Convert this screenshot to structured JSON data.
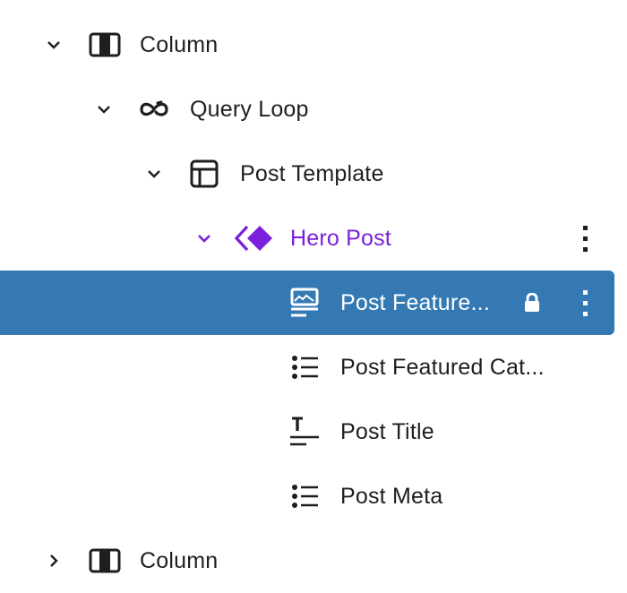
{
  "colors": {
    "text": "#1e1e1e",
    "accent_purple": "#7a1fdc",
    "selected_bg": "#3579b4",
    "selected_text": "#ffffff"
  },
  "list_view": {
    "items": [
      {
        "label": "Column",
        "icon": "columns-icon",
        "expanded": true,
        "level": 1
      },
      {
        "label": "Query Loop",
        "icon": "loop-icon",
        "expanded": true,
        "level": 2
      },
      {
        "label": "Post Template",
        "icon": "layout-icon",
        "expanded": true,
        "level": 3
      },
      {
        "label": "Hero Post",
        "icon": "reusable-block-icon",
        "expanded": true,
        "level": 4,
        "highlighted": true,
        "options_icon": "more-vertical-icon"
      },
      {
        "label": "Post Feature...",
        "icon": "featured-image-icon",
        "level": 5,
        "selected": true,
        "locked": true,
        "lock_icon": "lock-icon",
        "options_icon": "more-vertical-icon"
      },
      {
        "label": "Post Featured Cat...",
        "icon": "list-icon",
        "level": 5
      },
      {
        "label": "Post Title",
        "icon": "title-icon",
        "level": 5
      },
      {
        "label": "Post Meta",
        "icon": "list-icon",
        "level": 5
      },
      {
        "label": "Column",
        "icon": "columns-icon",
        "expanded": false,
        "level": 1
      }
    ]
  }
}
